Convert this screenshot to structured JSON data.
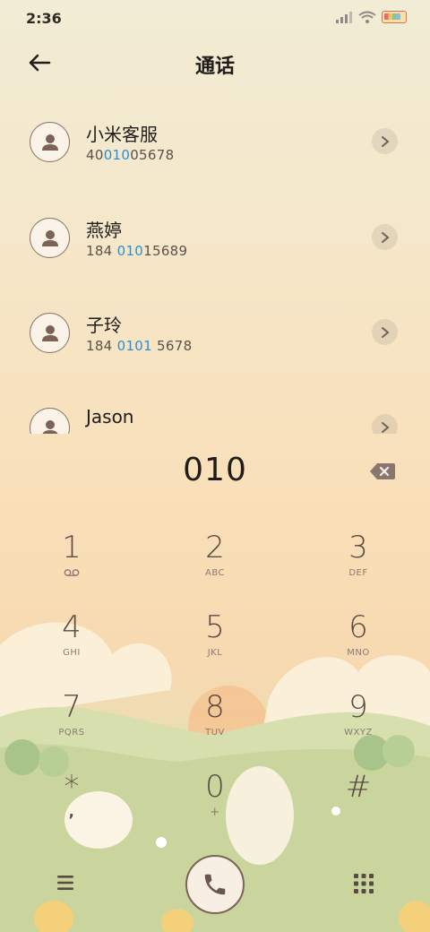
{
  "status_bar": {
    "time": "2:36",
    "icons": [
      "signal-icon",
      "wifi-icon",
      "battery-icon"
    ]
  },
  "header": {
    "title": "通话",
    "back_icon": "arrow-left-icon"
  },
  "search_query": "010",
  "contacts": [
    {
      "name": "小米客服",
      "number_parts": [
        "40",
        "010",
        "05678"
      ]
    },
    {
      "name": "燕婷",
      "number_parts": [
        "184 ",
        "010",
        "15689"
      ]
    },
    {
      "name": "子玲",
      "number_parts": [
        "184 ",
        "0101",
        " 5678"
      ]
    },
    {
      "name": "Jason",
      "number_parts": [
        "",
        "",
        ""
      ]
    }
  ],
  "keypad": [
    {
      "digit": "1",
      "letters": "",
      "icon": "voicemail-icon"
    },
    {
      "digit": "2",
      "letters": "ABC"
    },
    {
      "digit": "3",
      "letters": "DEF"
    },
    {
      "digit": "4",
      "letters": "GHI"
    },
    {
      "digit": "5",
      "letters": "JKL"
    },
    {
      "digit": "6",
      "letters": "MNO"
    },
    {
      "digit": "7",
      "letters": "PQRS"
    },
    {
      "digit": "8",
      "letters": "TUV"
    },
    {
      "digit": "9",
      "letters": "WXYZ"
    },
    {
      "digit": "*",
      "letters": ","
    },
    {
      "digit": "0",
      "letters": "+"
    },
    {
      "digit": "#",
      "letters": ""
    }
  ],
  "bottom_bar": {
    "icons": [
      "menu-icon",
      "phone-icon",
      "dialpad-icon"
    ]
  },
  "colors": {
    "highlight": "#2b8fd6",
    "accent": "#7b6358"
  }
}
